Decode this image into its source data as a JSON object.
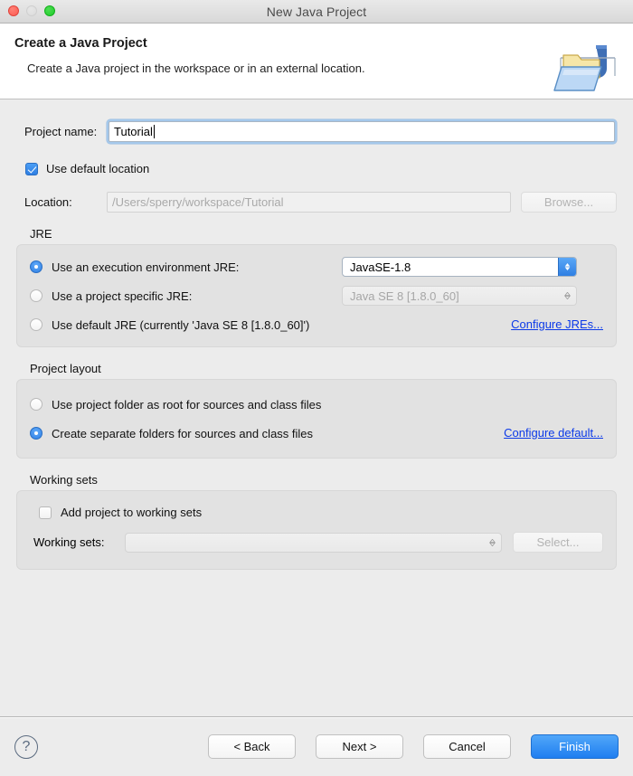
{
  "window": {
    "title": "New Java Project",
    "traffic_lights": [
      "close-button",
      "minimize-button",
      "zoom-button"
    ]
  },
  "banner": {
    "title": "Create a Java Project",
    "description": "Create a Java project in the workspace or in an external location.",
    "icon": "java-project-folder-icon"
  },
  "form": {
    "project_name": {
      "label": "Project name:",
      "value": "Tutorial",
      "placeholder": ""
    },
    "use_default_location": {
      "label": "Use default location",
      "checked": true
    },
    "location": {
      "label": "Location:",
      "value": "",
      "placeholder": "/Users/sperry/workspace/Tutorial",
      "browse_label": "Browse...",
      "browse_enabled": false
    }
  },
  "jre": {
    "group_title": "JRE",
    "options": [
      {
        "label": "Use an execution environment JRE:",
        "selected": true,
        "combo_value": "JavaSE-1.8",
        "combo_enabled": true
      },
      {
        "label": "Use a project specific JRE:",
        "selected": false,
        "combo_value": "Java SE 8 [1.8.0_60]",
        "combo_enabled": false
      },
      {
        "label": "Use default JRE (currently 'Java SE 8 [1.8.0_60]')",
        "selected": false
      }
    ],
    "configure_link": "Configure JREs..."
  },
  "project_layout": {
    "group_title": "Project layout",
    "options": [
      {
        "label": "Use project folder as root for sources and class files",
        "selected": false
      },
      {
        "label": "Create separate folders for sources and class files",
        "selected": true
      }
    ],
    "configure_link": "Configure default..."
  },
  "working_sets": {
    "group_title": "Working sets",
    "add_checkbox": {
      "label": "Add project to working sets",
      "checked": false
    },
    "sets_label": "Working sets:",
    "sets_value": "",
    "select_label": "Select...",
    "select_enabled": false
  },
  "footer": {
    "help_glyph": "?",
    "back_label": "< Back",
    "next_label": "Next >",
    "cancel_label": "Cancel",
    "finish_label": "Finish"
  },
  "colors": {
    "accent_blue": "#2f7fe3",
    "link_blue": "#0b39e8",
    "finish_blue": "#1f7ef0",
    "dialog_bg": "#ececec",
    "group_bg": "#e2e2e2"
  }
}
